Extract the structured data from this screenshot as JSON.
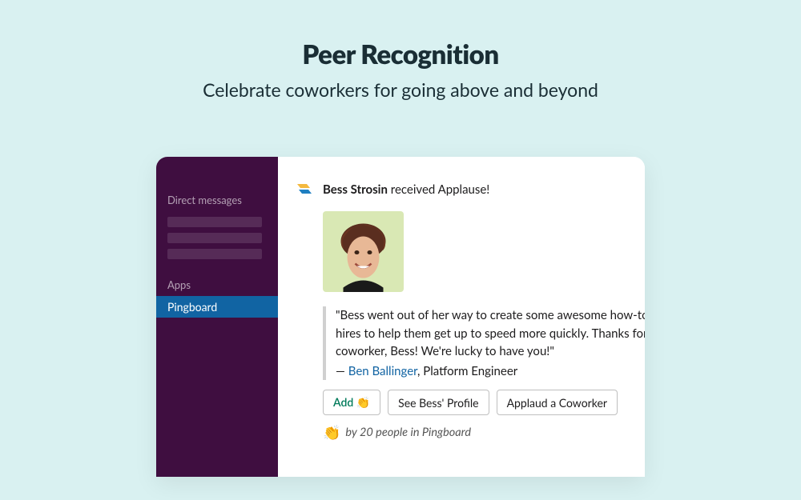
{
  "header": {
    "title": "Peer Recognition",
    "subtitle": "Celebrate coworkers for going above and beyond"
  },
  "sidebar": {
    "dm_label": "Direct messages",
    "apps_label": "Apps",
    "active_app": "Pingboard"
  },
  "message": {
    "recipient_name": "Bess Strosin",
    "action_text": " received Applause!",
    "quote_line1": "\"Bess went out of her way to create some awesome how-to videos for new",
    "quote_line2": "hires to help them get up to speed more quickly. Thanks for being a great",
    "quote_line3": "coworker, Bess! We're lucky to have you!\"",
    "attribution_prefix": "— ",
    "author": "Ben Ballinger",
    "author_title": ", Platform Engineer",
    "buttons": {
      "add": "Add 👏",
      "profile": "See Bess' Profile",
      "applaud": "Applaud a Coworker"
    },
    "reaction": {
      "emoji": "👏",
      "text": "by 20 people in Pingboard"
    }
  }
}
